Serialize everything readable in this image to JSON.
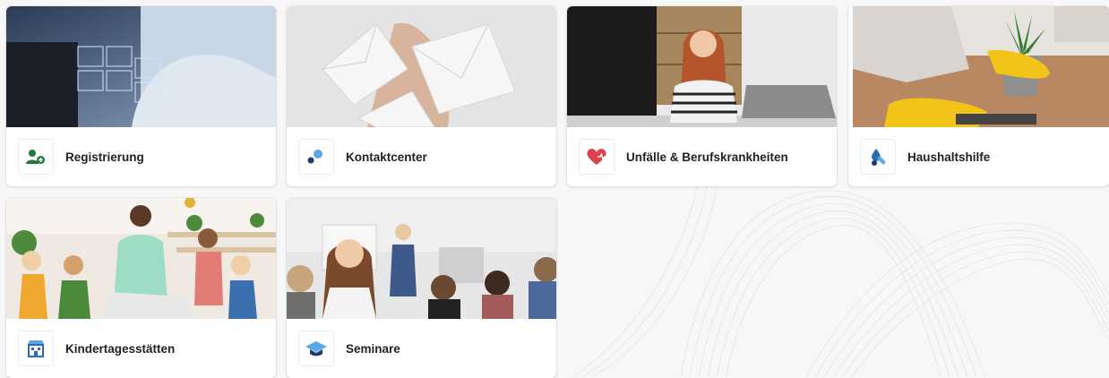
{
  "tiles": [
    {
      "label": "Registrierung",
      "icon": "add-user-icon"
    },
    {
      "label": "Kontaktcenter",
      "icon": "dots-icon"
    },
    {
      "label": "Unfälle & Berufskrankheiten",
      "icon": "heart-pulse-icon"
    },
    {
      "label": "Haushaltshilfe",
      "icon": "household-help-icon"
    },
    {
      "label": "Kindertagesstätten",
      "icon": "daycare-building-icon"
    },
    {
      "label": "Seminare",
      "icon": "graduation-cap-icon"
    }
  ],
  "colors": {
    "background": "#f7f7f7",
    "card": "#ffffff",
    "text": "#222222",
    "green_icon": "#1f7a3c",
    "blue_icon": "#2b6cb0",
    "red_icon": "#d9434d"
  }
}
